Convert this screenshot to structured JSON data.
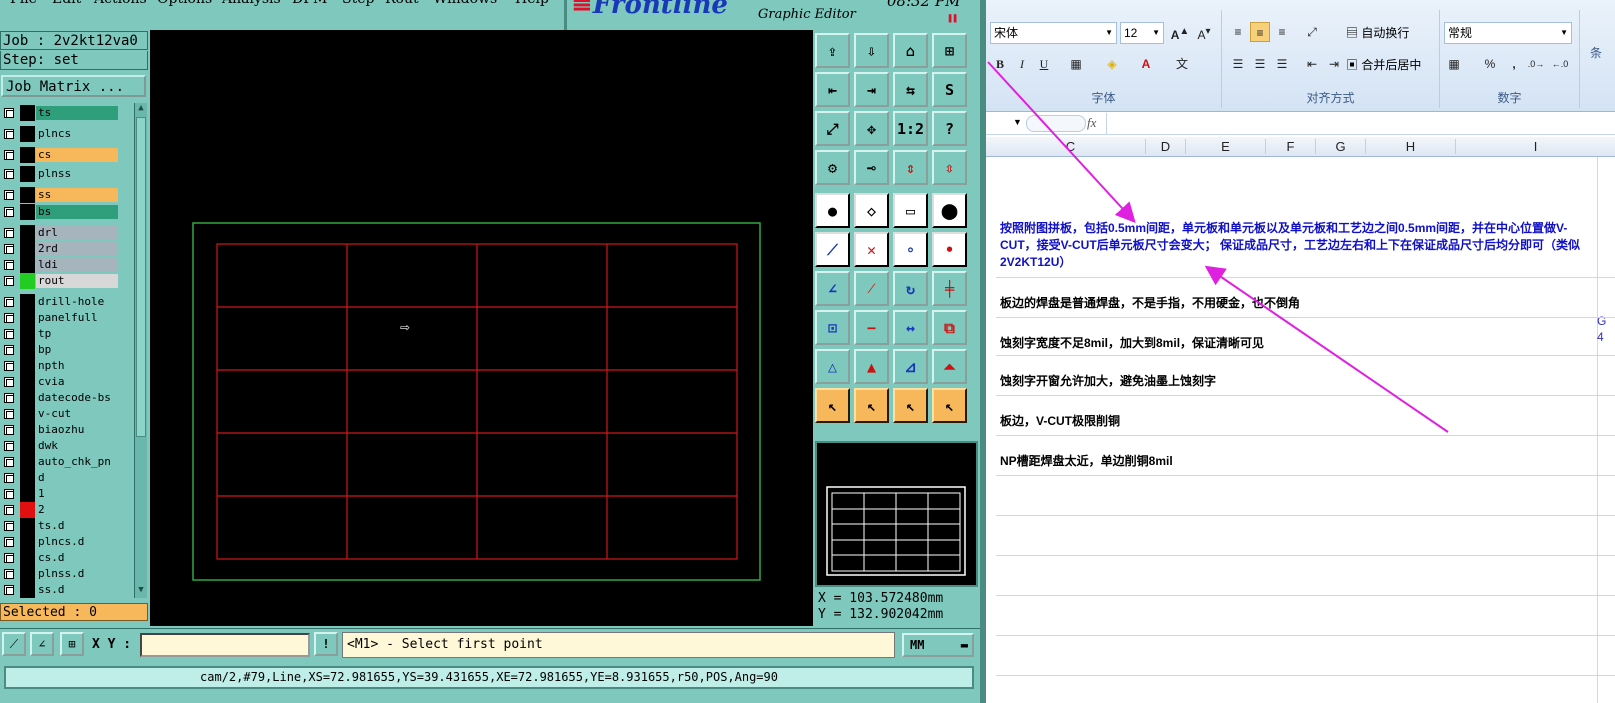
{
  "frontline": {
    "menu": [
      "File",
      "Edit",
      "Actions",
      "Options",
      "Analysis",
      "DFM",
      "Step",
      "Rout",
      "Windows",
      "Help"
    ],
    "brand": {
      "logo_pre": "",
      "logo": "Frontline",
      "subtitle": "Graphic Editor",
      "clock": "08:32 PM"
    },
    "job_label": "Job : 2v2kt12va0",
    "step_label": "Step: set",
    "job_matrix_label": "Job Matrix ...",
    "layers": [
      {
        "name": "ts",
        "color": "#2f9e7a",
        "swatch": "#000"
      },
      {
        "name": "plncs",
        "color": "#7ec8bd",
        "swatch": "#000"
      },
      {
        "name": "cs",
        "color": "#f6b85a",
        "swatch": "#000"
      },
      {
        "name": "plnss",
        "color": "#7ec8bd",
        "swatch": "#000"
      },
      {
        "name": "ss",
        "color": "#f6b85a",
        "swatch": "#000"
      },
      {
        "name": "bs",
        "color": "#2f9e7a",
        "swatch": "#000"
      },
      {
        "name": "drl",
        "color": "#a6b4bd",
        "swatch": "#000"
      },
      {
        "name": "2rd",
        "color": "#a6b4bd",
        "swatch": "#000"
      },
      {
        "name": "ldi",
        "color": "#a6b4bd",
        "swatch": "#000"
      },
      {
        "name": "rout",
        "color": "#d8d8d8",
        "swatch": "#22cc22"
      },
      {
        "name": "drill-hole",
        "color": "#7ec8bd",
        "swatch": "#000"
      },
      {
        "name": "panelfull",
        "color": "#7ec8bd",
        "swatch": "#000"
      },
      {
        "name": "tp",
        "color": "#7ec8bd",
        "swatch": "#000"
      },
      {
        "name": "bp",
        "color": "#7ec8bd",
        "swatch": "#000"
      },
      {
        "name": "npth",
        "color": "#7ec8bd",
        "swatch": "#000"
      },
      {
        "name": "cvia",
        "color": "#7ec8bd",
        "swatch": "#000"
      },
      {
        "name": "datecode-bs",
        "color": "#7ec8bd",
        "swatch": "#000"
      },
      {
        "name": "v-cut",
        "color": "#7ec8bd",
        "swatch": "#000"
      },
      {
        "name": "biaozhu",
        "color": "#7ec8bd",
        "swatch": "#000"
      },
      {
        "name": "dwk",
        "color": "#7ec8bd",
        "swatch": "#000"
      },
      {
        "name": "auto_chk_pn",
        "color": "#7ec8bd",
        "swatch": "#000"
      },
      {
        "name": "d",
        "color": "#7ec8bd",
        "swatch": "#000"
      },
      {
        "name": "1",
        "color": "#7ec8bd",
        "swatch": "#000"
      },
      {
        "name": "2",
        "color": "#7ec8bd",
        "swatch": "#e01010"
      },
      {
        "name": "ts.d",
        "color": "#7ec8bd",
        "swatch": "#000"
      },
      {
        "name": "plncs.d",
        "color": "#7ec8bd",
        "swatch": "#000"
      },
      {
        "name": "cs.d",
        "color": "#7ec8bd",
        "swatch": "#000"
      },
      {
        "name": "plnss.d",
        "color": "#7ec8bd",
        "swatch": "#000"
      },
      {
        "name": "ss.d",
        "color": "#7ec8bd",
        "swatch": "#000"
      }
    ],
    "selected_label": "Selected : 0",
    "coord_x": "X = 103.572480mm",
    "coord_y": "Y = 132.902042mm",
    "xy_label": "X Y :",
    "xy_value": "",
    "warn_icon": "!",
    "message": "<M1> - Select first point",
    "units": "MM",
    "status": "cam/2,#79,Line,XS=72.981655,YS=39.431655,XE=72.981655,YE=8.931655,r50,POS,Ang=90",
    "cursor_glyph": "⇨",
    "tools": [
      [
        "move-icon",
        "⇪"
      ],
      [
        "copy-icon",
        "⇩"
      ],
      [
        "home-icon",
        "⌂"
      ],
      [
        "xy-grid-icon",
        "⊞"
      ],
      [
        "import-icon",
        "⇤"
      ],
      [
        "export-icon",
        "⇥"
      ],
      [
        "swap-icon",
        "⇆"
      ],
      [
        "snap-icon",
        "S"
      ],
      [
        "fit-icon",
        "⤢"
      ],
      [
        "zoom-icon",
        "✥"
      ],
      [
        "ratio-icon",
        "1:2"
      ],
      [
        "help-icon",
        "?"
      ],
      [
        "settings-icon",
        "⚙"
      ],
      [
        "probe-icon",
        "⊸"
      ],
      [
        "measure-icon",
        "⇕"
      ],
      [
        "net-icon",
        "⇳"
      ],
      [
        "pad-add-icon",
        "●"
      ],
      [
        "shape-icon",
        "◇"
      ],
      [
        "ruler-icon",
        "▭"
      ],
      [
        "pad-icon",
        "⬤"
      ],
      [
        "line-add-icon",
        "⟋"
      ],
      [
        "cross-icon",
        "✕"
      ],
      [
        "node-icon",
        "∘"
      ],
      [
        "point-icon",
        "•"
      ],
      [
        "angle-icon",
        "∠"
      ],
      [
        "slash-icon",
        "⁄"
      ],
      [
        "rotate-icon",
        "↻"
      ],
      [
        "align-icon",
        "╪"
      ],
      [
        "select-pad-icon",
        "⊡"
      ],
      [
        "minus-icon",
        "−"
      ],
      [
        "dimension-icon",
        "↔"
      ],
      [
        "group-icon",
        "⧉"
      ],
      [
        "tri-a-icon",
        "△"
      ],
      [
        "tri-b-icon",
        "▲"
      ],
      [
        "tri-c-icon",
        "⊿"
      ],
      [
        "tri-d-icon",
        "⏶"
      ],
      [
        "arrow-a-icon",
        "↖"
      ],
      [
        "arrow-b-icon",
        "↖"
      ],
      [
        "arrow-c-icon",
        "↖"
      ],
      [
        "arrow-d-icon",
        "↖"
      ]
    ]
  },
  "excel": {
    "font_name": "宋体",
    "font_size": "12",
    "bold": "B",
    "italic": "I",
    "underline": "U",
    "wrap_text": "自动换行",
    "merge_center": "合并后居中",
    "number_format": "常规",
    "percent": "%",
    "comma": ",",
    "group_font": "字体",
    "group_align": "对齐方式",
    "group_number": "数字",
    "side_label": "条",
    "fx_label": "fx",
    "columns": [
      "C",
      "D",
      "E",
      "F",
      "G",
      "H",
      "I"
    ],
    "cells": [
      "按照附图拼板，包括0.5mm间距，单元板和单元板以及单元板和工艺边之间0.5mm间距，并在中心位置做V-CUT，接受V-CUT后单元板尺寸会变大；  保证成品尺寸，工艺边左右和上下在保证成品尺寸后均分即可（类似2V2KT12U）",
      "板边的焊盘是普通焊盘，不是手指，不用硬金，也不倒角",
      "蚀刻字宽度不足8mil，加大到8mil，保证清晰可见",
      "蚀刻字开窗允许加大，避免油墨上蚀刻字",
      "板边，V-CUT极限削铜",
      "NP槽距焊盘太近，单边削铜8mil"
    ],
    "edge_marks": [
      "G",
      "4"
    ]
  },
  "annotations": {
    "arrow_color": "#e020e0"
  }
}
